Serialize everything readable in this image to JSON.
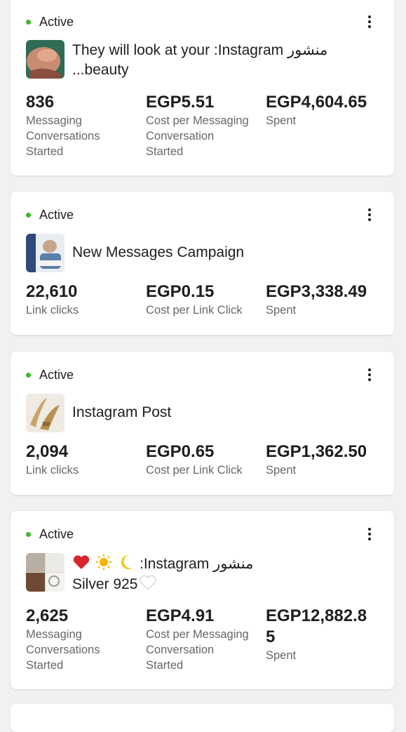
{
  "campaigns": [
    {
      "status": "Active",
      "title_line1": "They will look at your :Instagram منشور",
      "title_line2": "...beauty",
      "metrics": [
        {
          "value": "836",
          "label_lines": [
            "Messaging",
            "Conversations",
            "Started"
          ]
        },
        {
          "value": "EGP5.51",
          "label_lines": [
            "Cost per Messaging",
            "Conversation",
            "Started"
          ]
        },
        {
          "value": "EGP4,604.65",
          "label_lines": [
            "Spent"
          ]
        }
      ]
    },
    {
      "status": "Active",
      "title_line1": "New Messages Campaign",
      "metrics": [
        {
          "value": "22,610",
          "label_lines": [
            "Link clicks"
          ]
        },
        {
          "value": "EGP0.15",
          "label_lines": [
            "Cost per Link Click"
          ]
        },
        {
          "value": "EGP3,338.49",
          "label_lines": [
            "Spent"
          ]
        }
      ]
    },
    {
      "status": "Active",
      "title_line1": "Instagram Post",
      "metrics": [
        {
          "value": "2,094",
          "label_lines": [
            "Link clicks"
          ]
        },
        {
          "value": "EGP0.65",
          "label_lines": [
            "Cost per Link Click"
          ]
        },
        {
          "value": "EGP1,362.50",
          "label_lines": [
            "Spent"
          ]
        }
      ]
    },
    {
      "status": "Active",
      "title_line1_text": ":Instagram منشور",
      "title_line2": "Silver 925",
      "metrics": [
        {
          "value": "2,625",
          "label_lines": [
            "Messaging",
            "Conversations",
            "Started"
          ]
        },
        {
          "value": "EGP4.91",
          "label_lines": [
            "Cost per Messaging",
            "Conversation",
            "Started"
          ]
        },
        {
          "value_lines": [
            "EGP12,882.8",
            "5"
          ],
          "label_lines": [
            "Spent"
          ]
        }
      ]
    }
  ],
  "colors": {
    "active_dot": "#42b72a",
    "label_grey": "#65676b",
    "card_bg": "#ffffff",
    "page_bg": "#f0f1f2"
  },
  "icons": {
    "menu": "more-vertical-icon",
    "status": "active-dot-icon"
  }
}
